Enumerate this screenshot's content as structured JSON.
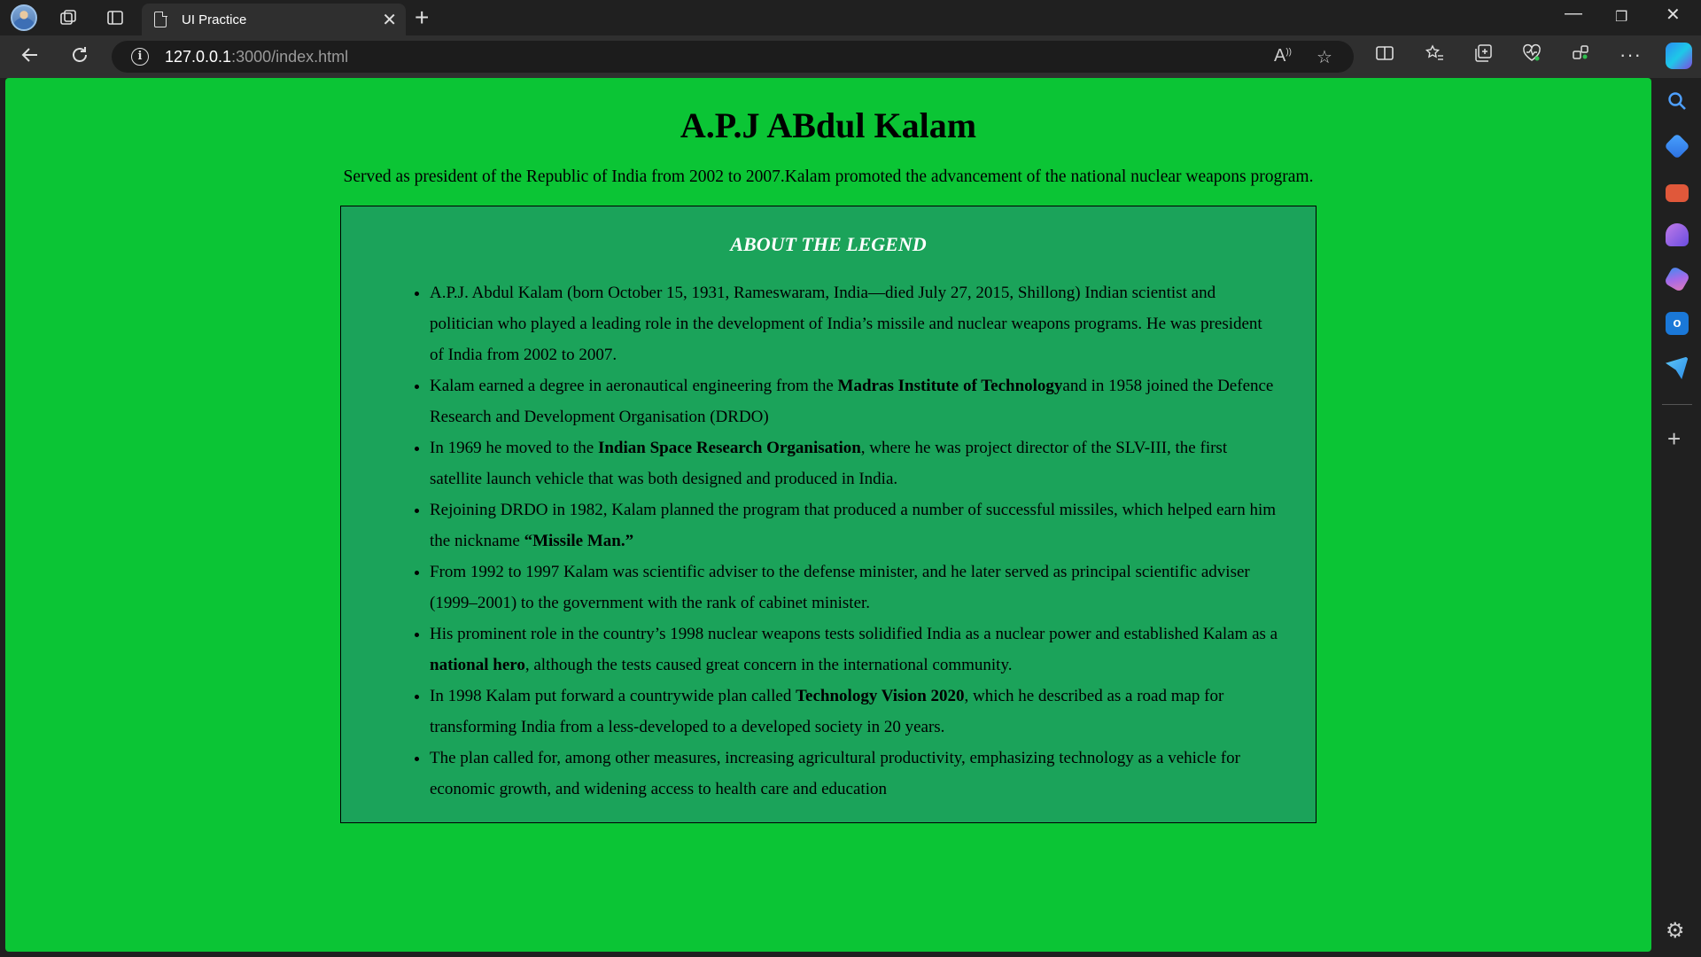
{
  "browser": {
    "tab_title": "UI Practice",
    "url_host": "127.0.0.1",
    "url_path": ":3000/index.html"
  },
  "page": {
    "title": "A.P.J ABdul Kalam",
    "intro": "Served as president of the Republic of India from 2002 to 2007.Kalam promoted the advancement of the national nuclear weapons program.",
    "card_heading": "ABOUT THE LEGEND",
    "facts": [
      {
        "before": "A.P.J. Abdul Kalam (born October 15, 1931, Rameswaram, India—died July 27, 2015, Shillong) Indian scientist and politician who played a leading role in the development of India’s missile and nuclear weapons programs. He was president of India from 2002 to 2007.",
        "bold": "",
        "after": ""
      },
      {
        "before": "Kalam earned a degree in aeronautical engineering from the ",
        "bold": "Madras Institute of Technology",
        "after": "and in 1958 joined the Defence Research and Development Organisation (DRDO)"
      },
      {
        "before": "In 1969 he moved to the ",
        "bold": "Indian Space Research Organisation",
        "after": ", where he was project director of the SLV-III, the first satellite launch vehicle that was both designed and produced in India."
      },
      {
        "before": "Rejoining DRDO in 1982, Kalam planned the program that produced a number of successful missiles, which helped earn him the nickname ",
        "bold": "“Missile Man.”",
        "after": ""
      },
      {
        "before": "From 1992 to 1997 Kalam was scientific adviser to the defense minister, and he later served as principal scientific adviser (1999–2001) to the government with the rank of cabinet minister.",
        "bold": "",
        "after": ""
      },
      {
        "before": "His prominent role in the country’s 1998 nuclear weapons tests solidified India as a nuclear power and established Kalam as a ",
        "bold": "national hero",
        "after": ", although the tests caused great concern in the international community."
      },
      {
        "before": "In 1998 Kalam put forward a countrywide plan called ",
        "bold": "Technology Vision 2020",
        "after": ", which he described as a road map for transforming India from a less-developed to a developed society in 20 years."
      },
      {
        "before": "The plan called for, among other measures, increasing agricultural productivity, emphasizing technology as a vehicle for economic growth, and widening access to health care and education",
        "bold": "",
        "after": ""
      }
    ]
  },
  "colors": {
    "page_bg": "#0bc535",
    "card_bg": "#1ba35a",
    "heading_text": "#ffffff"
  },
  "icons": {
    "titlebar": [
      "profile-avatar-icon",
      "workspaces-icon",
      "tab-actions-icon",
      "page-icon",
      "close-icon",
      "new-tab-icon",
      "minimize-icon",
      "restore-icon",
      "window-close-icon"
    ],
    "toolbar": [
      "back-icon",
      "refresh-icon",
      "info-icon",
      "read-aloud-icon",
      "favorite-star-icon",
      "split-screen-icon",
      "favorites-icon",
      "collections-icon",
      "browser-essentials-icon",
      "extensions-icon",
      "more-icon",
      "copilot-icon"
    ],
    "sidebar": [
      "search-icon",
      "shopping-icon",
      "tools-icon",
      "games-icon",
      "microsoft-365-icon",
      "outlook-icon",
      "drop-icon",
      "add-icon",
      "settings-icon"
    ]
  }
}
